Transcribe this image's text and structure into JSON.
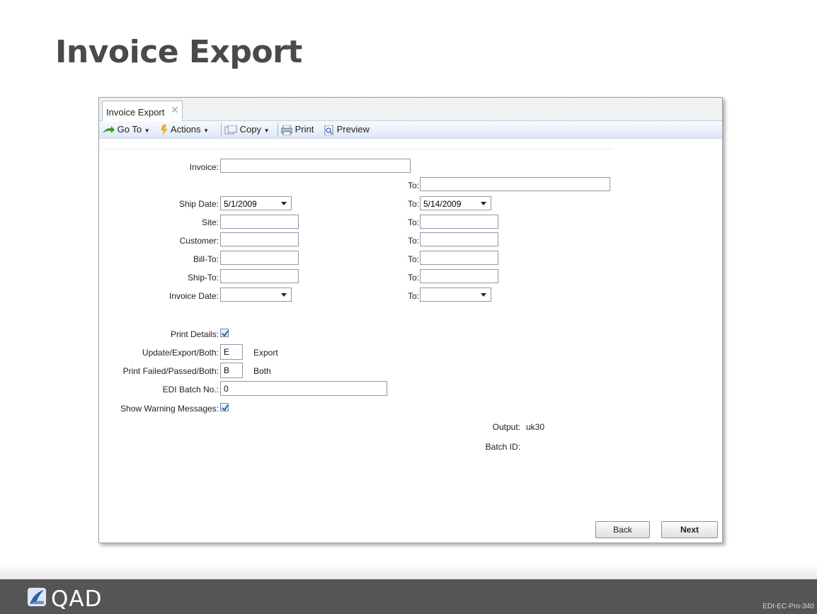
{
  "slide": {
    "title": "Invoice Export",
    "footer_code": "EDI-EC-Pro-340",
    "logo_text": "QAD"
  },
  "window": {
    "tab": {
      "label": "Invoice Export",
      "close": "✕"
    },
    "toolbar": {
      "goto": "Go To",
      "actions": "Actions",
      "copy": "Copy",
      "print": "Print",
      "preview": "Preview"
    },
    "form": {
      "invoice": {
        "label": "Invoice:",
        "value": "",
        "to_label": "To:",
        "to_value": ""
      },
      "ship_date": {
        "label": "Ship Date:",
        "value": "5/1/2009",
        "to_label": "To:",
        "to_value": "5/14/2009"
      },
      "site": {
        "label": "Site:",
        "value": "",
        "to_label": "To:",
        "to_value": ""
      },
      "customer": {
        "label": "Customer:",
        "value": "",
        "to_label": "To:",
        "to_value": ""
      },
      "bill_to": {
        "label": "Bill-To:",
        "value": "",
        "to_label": "To:",
        "to_value": ""
      },
      "ship_to": {
        "label": "Ship-To:",
        "value": "",
        "to_label": "To:",
        "to_value": ""
      },
      "invoice_date": {
        "label": "Invoice Date:",
        "value": "",
        "to_label": "To:",
        "to_value": ""
      },
      "print_details": {
        "label": "Print Details:",
        "checked": true
      },
      "update_export_both": {
        "label": "Update/Export/Both:",
        "value": "E",
        "desc": "Export"
      },
      "print_failed_passed": {
        "label": "Print Failed/Passed/Both:",
        "value": "B",
        "desc": "Both"
      },
      "edi_batch_no": {
        "label": "EDI Batch No.:",
        "value": "0"
      },
      "show_warning": {
        "label": "Show Warning Messages:",
        "checked": true
      },
      "output": {
        "label": "Output:",
        "value": "uk30"
      },
      "batch_id": {
        "label": "Batch ID:",
        "value": ""
      }
    },
    "buttons": {
      "back": "Back",
      "next": "Next"
    }
  },
  "colors": {
    "footer": "#555555",
    "title": "#4a4a4a",
    "checkbox_border": "#6e8ab0"
  }
}
